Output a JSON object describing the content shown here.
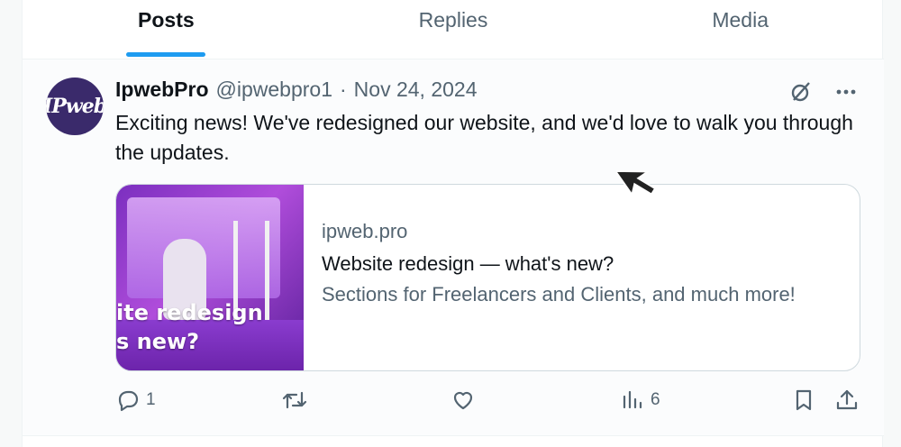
{
  "tabs": [
    {
      "label": "Posts",
      "active": true
    },
    {
      "label": "Replies",
      "active": false
    },
    {
      "label": "Media",
      "active": false
    }
  ],
  "tweet": {
    "author_name": "IpwebPro",
    "author_handle": "@ipwebpro1",
    "separator": "·",
    "date": "Nov 24, 2024",
    "avatar_text": "IPweb",
    "text": "Exciting news! We've redesigned our website, and we'd love to walk you through the updates.",
    "header_icons": [
      "grok-icon",
      "more-icon"
    ]
  },
  "card": {
    "domain": "ipweb.pro",
    "title": "Website redesign — what's new?",
    "description": "Sections for Freelancers and Clients, and much more!",
    "image_overlay_line1": "ite redesign",
    "image_overlay_line2": "s new?"
  },
  "actions": {
    "reply_count": "1",
    "repost_count": "",
    "like_count": "",
    "views_count": "6"
  },
  "colors": {
    "accent": "#1d9bf0",
    "text_primary": "#0f1419",
    "text_secondary": "#536471",
    "avatar_bg": "#3a2a6b"
  }
}
